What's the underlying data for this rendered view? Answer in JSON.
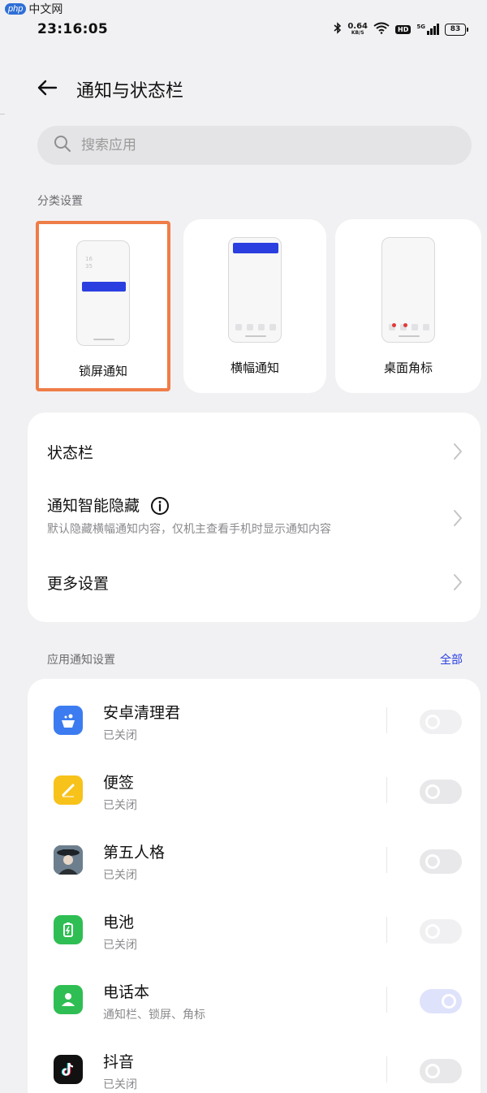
{
  "watermark": {
    "logo": "php",
    "text": "中文网"
  },
  "status_bar": {
    "time": "23:16:05",
    "net_speed_value": "0.64",
    "net_speed_unit": "KB/S",
    "hd": "HD",
    "network": "5G",
    "battery": "83"
  },
  "header": {
    "title": "通知与状态栏",
    "back_icon": "arrow-left-icon"
  },
  "search": {
    "placeholder": "搜索应用",
    "value": ""
  },
  "categories": {
    "label": "分类设置",
    "items": [
      {
        "label": "锁屏通知",
        "selected": true,
        "lock_time": "16\n35"
      },
      {
        "label": "横幅通知",
        "selected": false
      },
      {
        "label": "桌面角标",
        "selected": false
      }
    ]
  },
  "settings": {
    "status_bar": {
      "title": "状态栏"
    },
    "smart_hide": {
      "title": "通知智能隐藏",
      "subtitle": "默认隐藏横幅通知内容，仅机主查看手机时显示通知内容"
    },
    "more": {
      "title": "更多设置"
    }
  },
  "app_notifications": {
    "label": "应用通知设置",
    "all_link": "全部",
    "apps": [
      {
        "name": "安卓清理君",
        "status": "已关闭",
        "enabled": false,
        "icon": "cleaner-icon",
        "color": "#3c7cf0"
      },
      {
        "name": "便签",
        "status": "已关闭",
        "enabled": false,
        "icon": "notes-icon",
        "color": "#f7c21a"
      },
      {
        "name": "第五人格",
        "status": "已关闭",
        "enabled": false,
        "icon": "game-avatar-icon",
        "color": "#4a5a6a"
      },
      {
        "name": "电池",
        "status": "已关闭",
        "enabled": false,
        "icon": "battery-icon",
        "color": "#2fbe53"
      },
      {
        "name": "电话本",
        "status": "通知栏、锁屏、角标",
        "enabled": true,
        "icon": "contacts-icon",
        "color": "#2fbe53"
      },
      {
        "name": "抖音",
        "status": "已关闭",
        "enabled": false,
        "icon": "tiktok-icon",
        "color": "#111111"
      }
    ]
  },
  "colors": {
    "accent": "#2b3fe0",
    "selected_outline": "#ef7d47",
    "background": "#f1f1f3"
  }
}
